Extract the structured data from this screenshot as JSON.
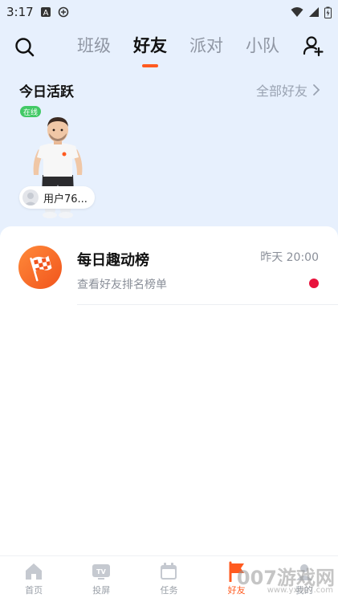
{
  "status_bar": {
    "time": "3:17"
  },
  "header": {
    "tabs": [
      {
        "label": "班级"
      },
      {
        "label": "好友"
      },
      {
        "label": "派对"
      },
      {
        "label": "小队"
      }
    ],
    "active_tab": "好友"
  },
  "active_today": {
    "title": "今日活跃",
    "all_friends_label": "全部好友",
    "friend": {
      "status": "在线",
      "name": "用户76..."
    }
  },
  "list": [
    {
      "title": "每日趣动榜",
      "subtitle": "查看好友排名榜单",
      "time": "昨天 20:00",
      "unread": true
    }
  ],
  "bottom_nav": [
    {
      "label": "首页",
      "icon": "home-icon"
    },
    {
      "label": "投屏",
      "icon": "tv-icon"
    },
    {
      "label": "任务",
      "icon": "calendar-icon"
    },
    {
      "label": "好友",
      "icon": "flag-icon",
      "active": true
    },
    {
      "label": "我的",
      "icon": "profile-icon"
    }
  ],
  "watermark": {
    "text": "007游戏网",
    "sub": "www.yx007.com"
  },
  "colors": {
    "accent": "#ff5a1f",
    "top_bg": "#e7f0fd",
    "online": "#42c966",
    "unread_dot": "#e8123c"
  }
}
